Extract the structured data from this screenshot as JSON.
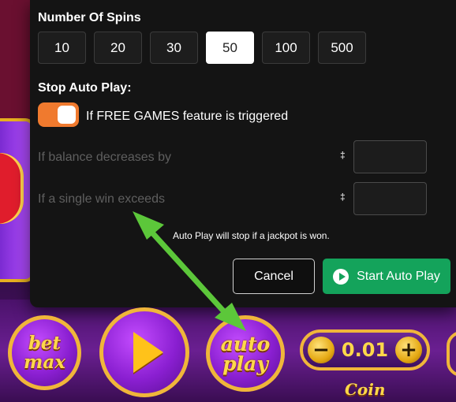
{
  "spins": {
    "title": "Number Of Spins",
    "options": [
      "10",
      "20",
      "30",
      "50",
      "100",
      "500"
    ],
    "selected": "50"
  },
  "stop": {
    "title": "Stop Auto Play:",
    "free_games_label": "If FREE GAMES feature is triggered",
    "free_games_enabled": true,
    "balance_label": "If balance decreases by",
    "single_win_label": "If a single win exceeds",
    "currency_symbol": "‡",
    "balance_value": "",
    "single_win_value": "",
    "jackpot_note": "Auto Play will stop if a jackpot is won."
  },
  "actions": {
    "cancel_label": "Cancel",
    "start_label": "Start Auto Play"
  },
  "game_controls": {
    "bet_max_line1": "bet",
    "bet_max_line2": "max",
    "auto_line1": "auto",
    "auto_line2": "play",
    "coin_minus": "−",
    "coin_plus": "+",
    "coin_value": "0.01",
    "coin_label": "Coin"
  },
  "colors": {
    "toggle_on": "#f07a2e",
    "start_button": "#14a35b",
    "annotation_arrow": "#5cc73a"
  }
}
